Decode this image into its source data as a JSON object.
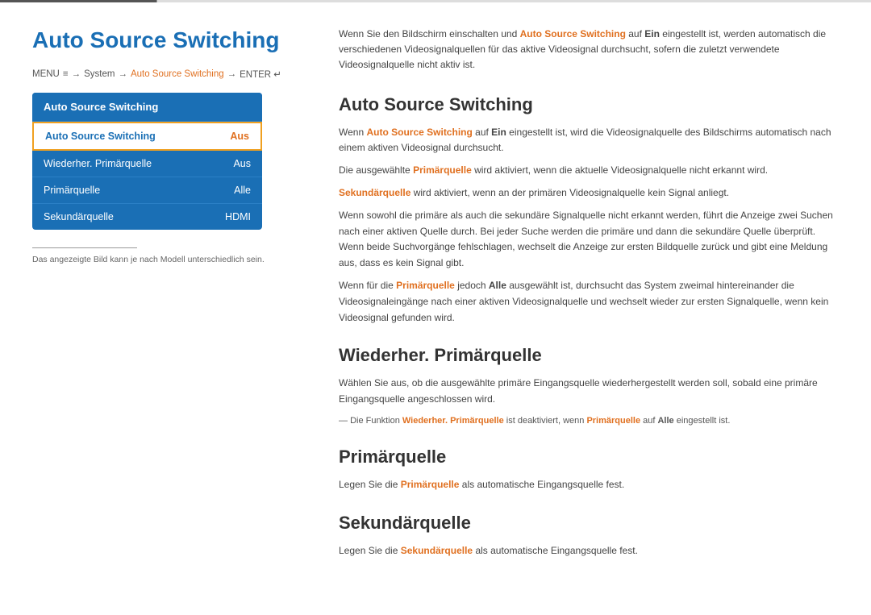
{
  "top_line": {},
  "left": {
    "title": "Auto Source Switching",
    "menu_path": {
      "menu": "MENU",
      "icon": "≡",
      "arrow1": "→",
      "system": "System",
      "arrow2": "→",
      "highlight": "Auto Source Switching",
      "arrow3": "→",
      "enter": "ENTER",
      "enter_icon": "↵"
    },
    "menu_box_header": "Auto Source Switching",
    "menu_items": [
      {
        "label": "Auto Source Switching",
        "value": "Aus",
        "selected": true
      },
      {
        "label": "Wiederher. Primärquelle",
        "value": "Aus",
        "selected": false
      },
      {
        "label": "Primärquelle",
        "value": "Alle",
        "selected": false
      },
      {
        "label": "Sekundärquelle",
        "value": "HDMI",
        "selected": false
      }
    ],
    "footnote": "— Das angezeigte Bild kann je nach Modell unterschiedlich sein."
  },
  "right": {
    "intro": "Wenn Sie den Bildschirm einschalten und Auto Source Switching auf Ein eingestellt ist, werden automatisch die verschiedenen Videosignalquellen für das aktive Videosignal durchsucht, sofern die zuletzt verwendete Videosignalquelle nicht aktiv ist.",
    "sections": [
      {
        "id": "auto-source-switching",
        "title": "Auto Source Switching",
        "paragraphs": [
          "Wenn Auto Source Switching auf Ein eingestellt ist, wird die Videosignalquelle des Bildschirms automatisch nach einem aktiven Videosignal durchsucht.",
          "Die ausgewählte Primärquelle wird aktiviert, wenn die aktuelle Videosignalquelle nicht erkannt wird.",
          "Sekundärquelle wird aktiviert, wenn an der primären Videosignalquelle kein Signal anliegt.",
          "Wenn sowohl die primäre als auch die sekundäre Signalquelle nicht erkannt werden, führt die Anzeige zwei Suchen nach einer aktiven Quelle durch. Bei jeder Suche werden die primäre und dann die sekundäre Quelle überprüft.  Wenn beide Suchvorgänge fehlschlagen, wechselt die Anzeige zur ersten Bildquelle zurück und gibt eine Meldung aus, dass es kein Signal gibt.",
          "Wenn für die Primärquelle jedoch Alle ausgewählt ist, durchsucht das System zweimal hintereinander die Videosignaleingänge nach einer aktiven Videosignalquelle und wechselt wieder zur ersten Signalquelle, wenn kein Videosignal gefunden wird."
        ]
      },
      {
        "id": "wiederher-primaerquelle",
        "title": "Wiederher. Primärquelle",
        "paragraphs": [
          "Wählen Sie aus, ob die ausgewählte primäre Eingangsquelle wiederhergestellt werden soll, sobald eine primäre Eingangsquelle angeschlossen wird."
        ],
        "note": "Die Funktion Wiederher. Primärquelle ist deaktiviert, wenn Primärquelle auf Alle eingestellt ist."
      },
      {
        "id": "primaerquelle",
        "title": "Primärquelle",
        "paragraphs": [
          "Legen Sie die Primärquelle als automatische Eingangsquelle fest."
        ]
      },
      {
        "id": "sekundaerquelle",
        "title": "Sekundärquelle",
        "paragraphs": [
          "Legen Sie die Sekundärquelle als automatische Eingangsquelle fest."
        ]
      }
    ]
  }
}
